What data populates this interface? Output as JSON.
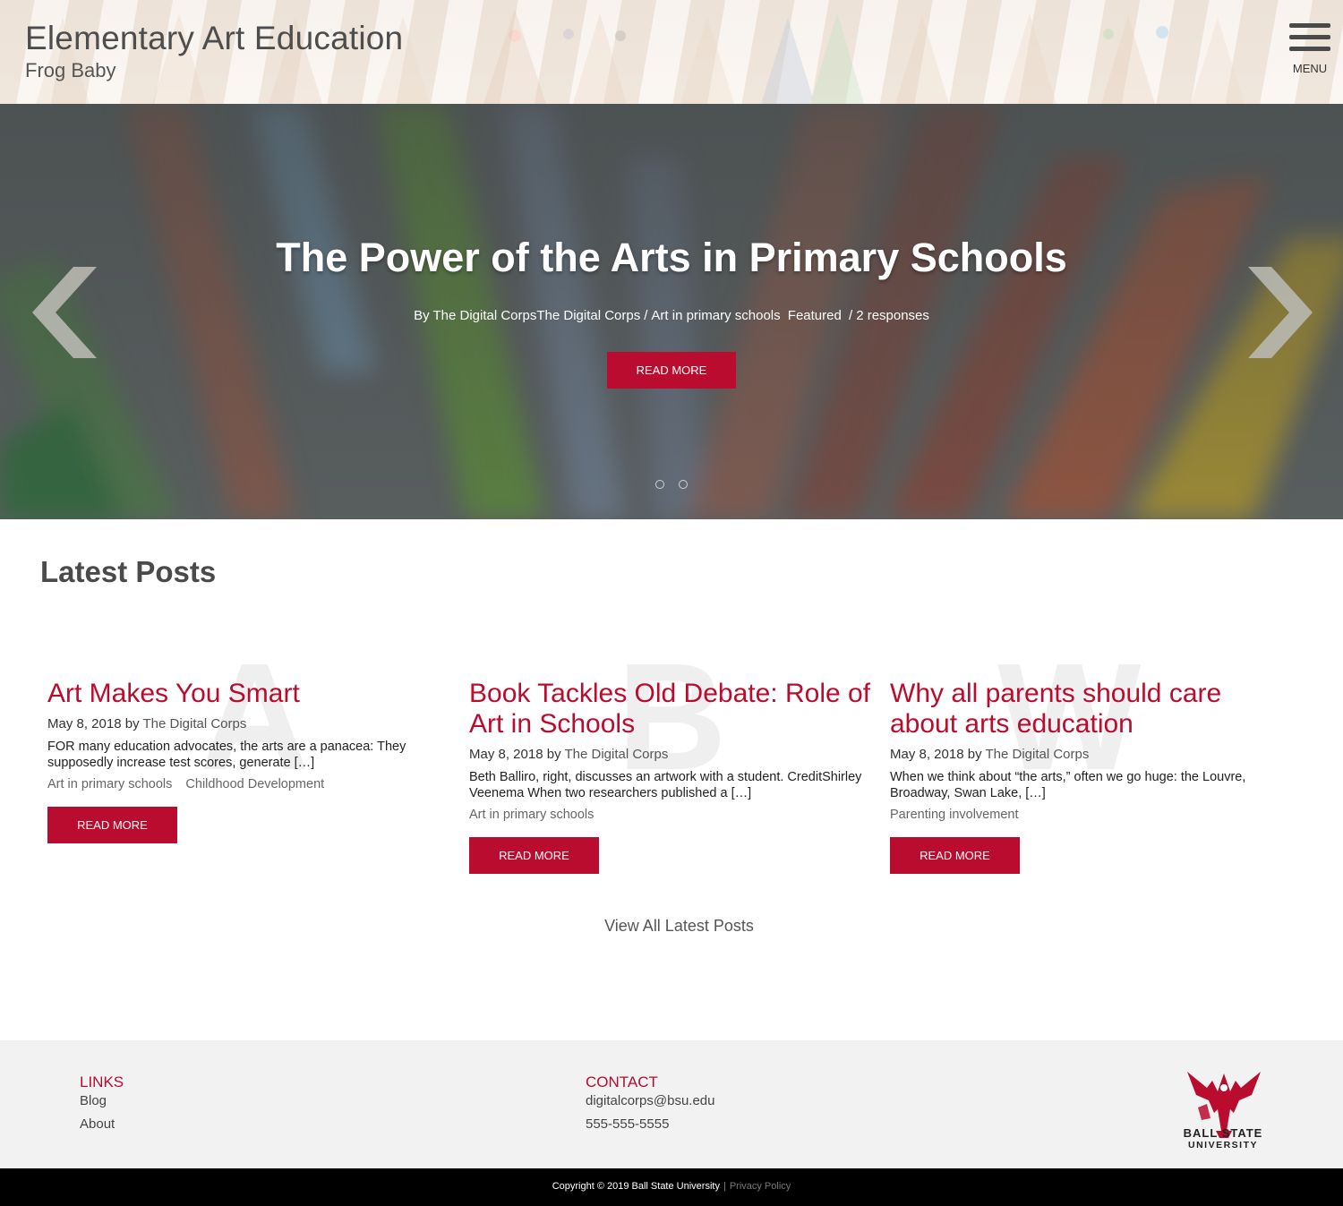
{
  "header": {
    "title": "Elementary Art Education",
    "subtitle": "Frog Baby",
    "menu_label": "MENU"
  },
  "hero": {
    "title": "The Power of the Arts in Primary Schools",
    "meta": {
      "author": "By The Digital CorpsThe Digital Corps",
      "category": "Art in primary schools",
      "tag": "Featured",
      "responses": "2 responses"
    },
    "button_label": "READ MORE",
    "slide_count": 2
  },
  "latest": {
    "title": "Latest Posts",
    "posts": [
      {
        "letter": "A",
        "title": "Art Makes You Smart",
        "date": "May 8, 2018",
        "by": "by",
        "author": "The Digital Corps",
        "excerpt": "FOR many education advocates, the arts are a panacea: They supposedly increase test scores, generate […]",
        "tags": [
          "Art in primary schools",
          "Childhood Development"
        ],
        "button_label": "READ MORE"
      },
      {
        "letter": "B",
        "title": "Book Tackles Old Debate: Role of Art in Schools",
        "date": "May 8, 2018",
        "by": "by",
        "author": "The Digital Corps",
        "excerpt": "Beth Balliro, right, discusses an artwork with a student. CreditShirley Veenema When two researchers published a […]",
        "tags": [
          "Art in primary schools"
        ],
        "button_label": "READ MORE"
      },
      {
        "letter": "W",
        "title": "Why all parents should care about arts education",
        "date": "May 8, 2018",
        "by": "by",
        "author": "The Digital Corps",
        "excerpt": "When we think about “the arts,” often we go huge: the Louvre, Broadway, Swan Lake, […]",
        "tags": [
          "Parenting involvement"
        ],
        "button_label": "READ MORE"
      }
    ],
    "view_all": "View All Latest Posts"
  },
  "footer": {
    "links_heading": "LINKS",
    "links": [
      "Blog",
      "About"
    ],
    "contact_heading": "CONTACT",
    "email": "digitalcorps@bsu.edu",
    "phone": "555-555-5555",
    "logo_line1": "BALL STATE",
    "logo_line2": "UNIVERSITY"
  },
  "bottom": {
    "copyright": "Copyright © 2019 Ball State University",
    "separator": "|",
    "privacy": "Privacy Policy"
  },
  "colors": {
    "accent": "#ba0c2f",
    "footer_bg": "#f2f2f2",
    "bottom_bar": "#000000"
  },
  "icons": {
    "menu": "hamburger-icon",
    "prev": "chevron-left-icon",
    "next": "chevron-right-icon",
    "logo": "cardinal-logo-icon"
  }
}
